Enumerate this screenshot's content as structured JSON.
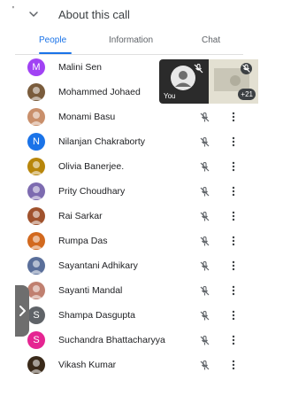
{
  "header": {
    "mark": "'",
    "title": "About this call"
  },
  "tabs": [
    {
      "label": "People",
      "active": true
    },
    {
      "label": "Information",
      "active": false
    },
    {
      "label": "Chat",
      "active": false
    }
  ],
  "participants": [
    {
      "name": "Malini Sen",
      "initial": "M",
      "avatar_color": "#a142f4"
    },
    {
      "name": "Mohammed Johaed",
      "initial": "",
      "avatar_color": "#7a5c3c"
    },
    {
      "name": "Monami Basu",
      "initial": "",
      "avatar_color": "#c98f6b"
    },
    {
      "name": "Nilanjan Chakraborty",
      "initial": "N",
      "avatar_color": "#1a73e8"
    },
    {
      "name": "Olivia Banerjee.",
      "initial": "",
      "avatar_color": "#b8860b"
    },
    {
      "name": "Prity Choudhary",
      "initial": "",
      "avatar_color": "#7d6bb0"
    },
    {
      "name": "Rai Sarkar",
      "initial": "",
      "avatar_color": "#a0522d"
    },
    {
      "name": "Rumpa Das",
      "initial": "",
      "avatar_color": "#d2691e"
    },
    {
      "name": "Sayantani Adhikary",
      "initial": "",
      "avatar_color": "#5a6f9a"
    },
    {
      "name": "Sayanti Mandal",
      "initial": "",
      "avatar_color": "#c08070"
    },
    {
      "name": "Shampa Dasgupta",
      "initial": "S",
      "avatar_color": "#5f6368"
    },
    {
      "name": "Suchandra Bhattacharyya",
      "initial": "S",
      "avatar_color": "#e52592"
    },
    {
      "name": "Vikash Kumar",
      "initial": "",
      "avatar_color": "#3a2a1a"
    }
  ],
  "video_tiles": {
    "self_label": "You",
    "more_count": "+21"
  },
  "colors": {
    "accent": "#1a73e8",
    "text": "#202124",
    "muted": "#5f6368"
  }
}
